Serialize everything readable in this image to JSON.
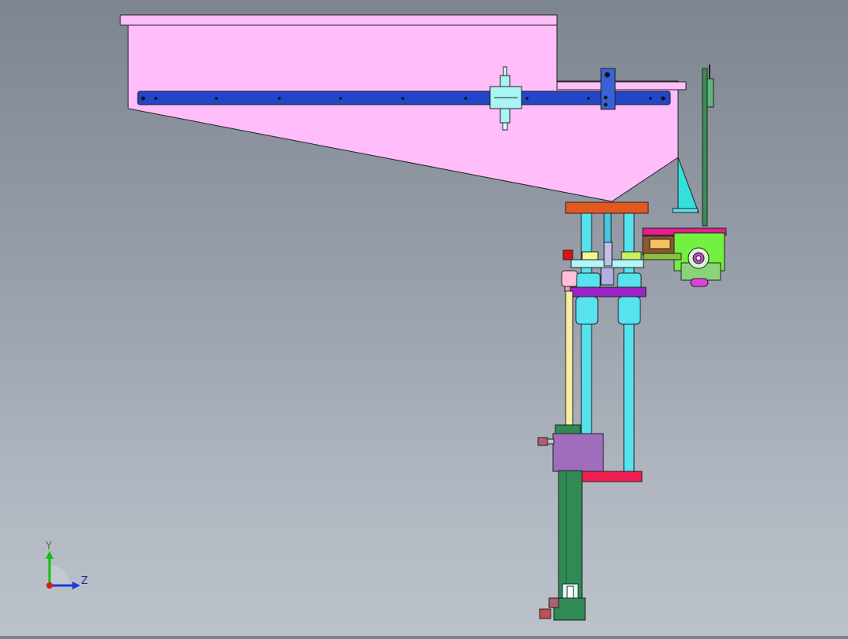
{
  "axis_triad": {
    "y_label": "Y",
    "z_label": "Z"
  },
  "colors": {
    "hopper": "#ffbdf9",
    "rail": "#2246c7",
    "column": "#56e2ee",
    "top_block": "#e2581e",
    "bottom_block": "#f01d52",
    "slider_plate": "#9b23c9",
    "motor_body": "#73f040",
    "cylinder": "#2f8a55",
    "valve_block": "#a06cbc",
    "triad_y": "#10c010",
    "triad_z": "#1d3bd8",
    "triad_x": "#e01818"
  }
}
